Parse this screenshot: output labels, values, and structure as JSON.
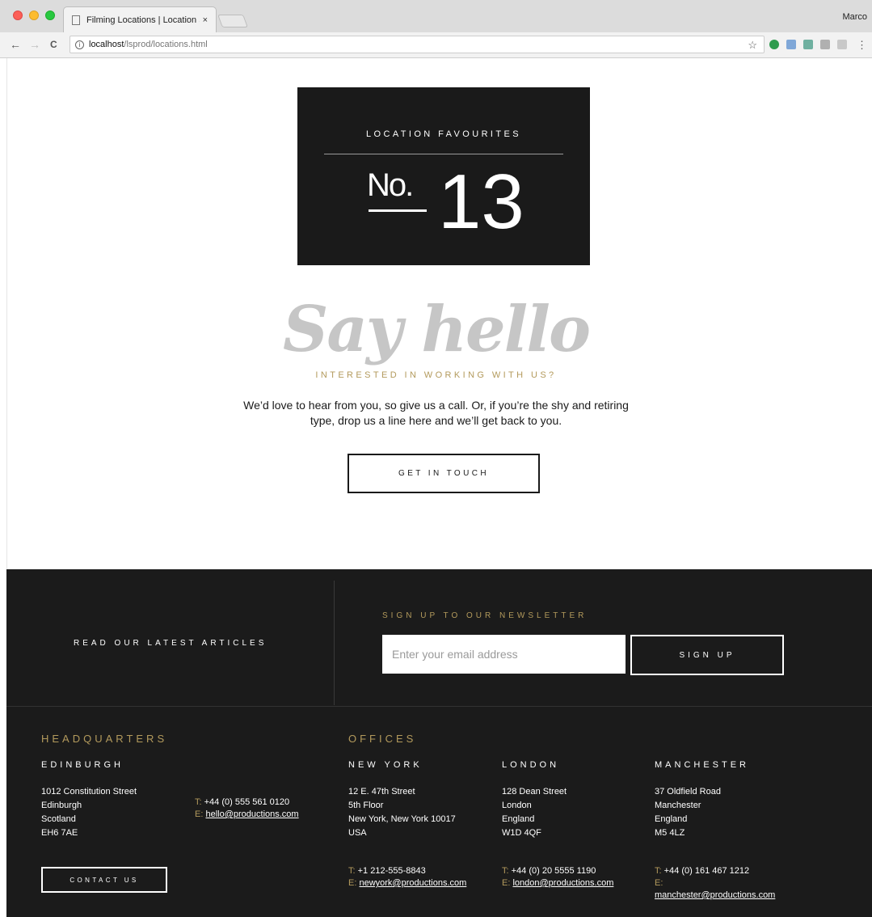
{
  "browser": {
    "tab_title": "Filming Locations | Location Sc",
    "tab_close": "×",
    "profile_name": "Marco",
    "url_host": "localhost",
    "url_path": "/lsprod/locations.html",
    "url_info": "i",
    "back": "←",
    "forward": "→",
    "reload": "C",
    "star": "☆",
    "menu": "⋮"
  },
  "badge": {
    "label": "LOCATION FAVOURITES",
    "no_text": "No.",
    "number": "13"
  },
  "hero": {
    "script_heading": "Say hello",
    "subheading": "INTERESTED IN WORKING WITH US?",
    "intro_line1": "We’d love to hear from you, so give us a call. Or, if you’re the shy and retiring",
    "intro_line2": "type, drop us a line here and we’ll get back to you.",
    "cta_label": "GET IN TOUCH"
  },
  "footer": {
    "articles_label": "READ OUR LATEST ARTICLES",
    "newsletter_title": "SIGN UP TO OUR NEWSLETTER",
    "email_placeholder": "Enter your email address",
    "signup_label": "SIGN UP",
    "hq_heading": "HEADQUARTERS",
    "offices_heading": "OFFICES",
    "contact_label": "CONTACT US",
    "locations": {
      "edinburgh": {
        "city": "EDINBURGH",
        "address": [
          "1012 Constitution Street",
          "Edinburgh",
          "Scotland",
          "EH6 7AE"
        ],
        "t_label": "T:",
        "phone": "+44 (0) 555 561 0120",
        "e_label": "E:",
        "email": "hello@productions.com"
      },
      "newyork": {
        "city": "NEW YORK",
        "address": [
          "12 E. 47th Street",
          "5th Floor",
          "New York, New York 10017",
          "USA"
        ],
        "t_label": "T:",
        "phone": "+1 212-555-8843",
        "e_label": "E:",
        "email": "newyork@productions.com"
      },
      "london": {
        "city": "LONDON",
        "address": [
          "128 Dean Street",
          "London",
          "England",
          "W1D 4QF"
        ],
        "t_label": "T:",
        "phone": "+44 (0) 20 5555 1190",
        "e_label": "E:",
        "email": "london@productions.com"
      },
      "manchester": {
        "city": "MANCHESTER",
        "address": [
          "37 Oldfield Road",
          "Manchester",
          "England",
          "M5 4LZ"
        ],
        "t_label": "T:",
        "phone": "+44 (0) 161 467 1212",
        "e_label": "E:",
        "email": "manchester@productions.com"
      }
    }
  },
  "colors": {
    "dark": "#1b1b1b",
    "gold": "#b39a5c",
    "heading_grey": "#c6c6c6"
  }
}
